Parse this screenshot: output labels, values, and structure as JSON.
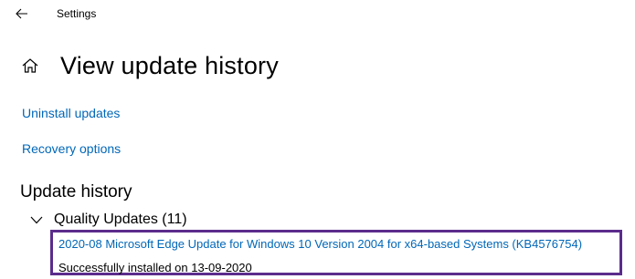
{
  "window": {
    "title": "Settings"
  },
  "header": {
    "title": "View update history"
  },
  "links": {
    "uninstall": "Uninstall updates",
    "recovery": "Recovery options"
  },
  "history": {
    "section_title": "Update history",
    "categories": [
      {
        "label": "Quality Updates (11)",
        "expanded": true,
        "items": [
          {
            "title": "2020-08 Microsoft Edge Update for Windows 10 Version 2004 for x64-based Systems (KB4576754)",
            "status": "Successfully installed on 13-09-2020"
          }
        ]
      }
    ]
  },
  "icons": {
    "back": "back-arrow-icon",
    "home": "home-icon",
    "expand": "chevron-down-icon"
  },
  "colors": {
    "link": "#0067b8",
    "highlight": "#5b2c8c",
    "text": "#000000",
    "background": "#ffffff"
  }
}
